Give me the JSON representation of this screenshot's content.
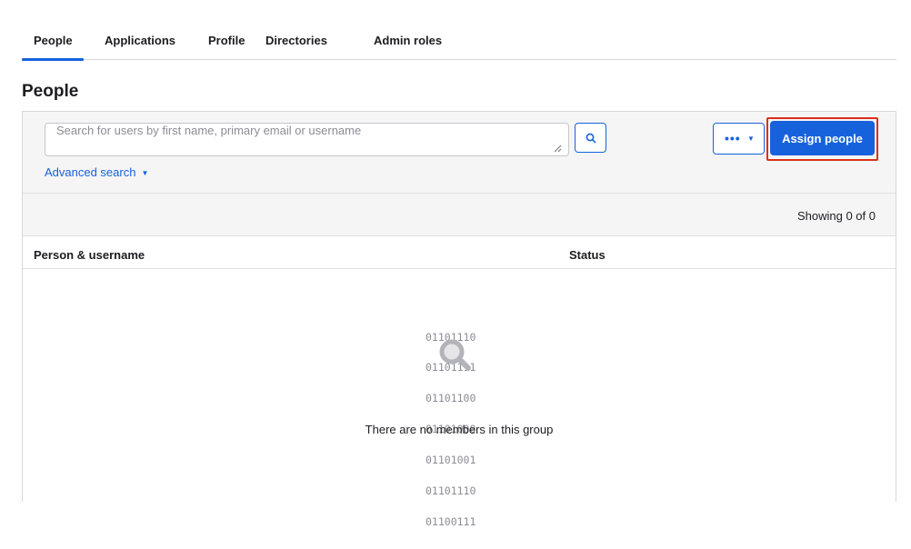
{
  "tabs": [
    {
      "label": "People",
      "active": true
    },
    {
      "label": "Applications",
      "active": false
    },
    {
      "label": "Profile",
      "active": false
    },
    {
      "label": "Directories",
      "active": false
    },
    {
      "label": "Admin roles",
      "active": false
    }
  ],
  "page": {
    "title": "People"
  },
  "toolbar": {
    "search_placeholder": "Search for users by first name, primary email or username",
    "search_value": "",
    "search_icon": "search-icon",
    "advanced_search_label": "Advanced search",
    "advanced_search_caret": "▼",
    "more_label": "•••",
    "more_caret": "▼",
    "assign_label": "Assign people"
  },
  "results": {
    "showing_text": "Showing 0 of 0"
  },
  "table": {
    "columns": [
      "Person & username",
      "Status"
    ]
  },
  "empty_state": {
    "binary_lines": [
      "01101110",
      "01101111",
      "01101100",
      "01101000",
      "01101001",
      "01101110",
      "01100111"
    ],
    "message": "There are no members in this group",
    "icon": "magnifier-icon"
  },
  "colors": {
    "accent": "#1662dd",
    "highlight": "#d9301c",
    "toolbar_bg": "#f5f5f6"
  }
}
